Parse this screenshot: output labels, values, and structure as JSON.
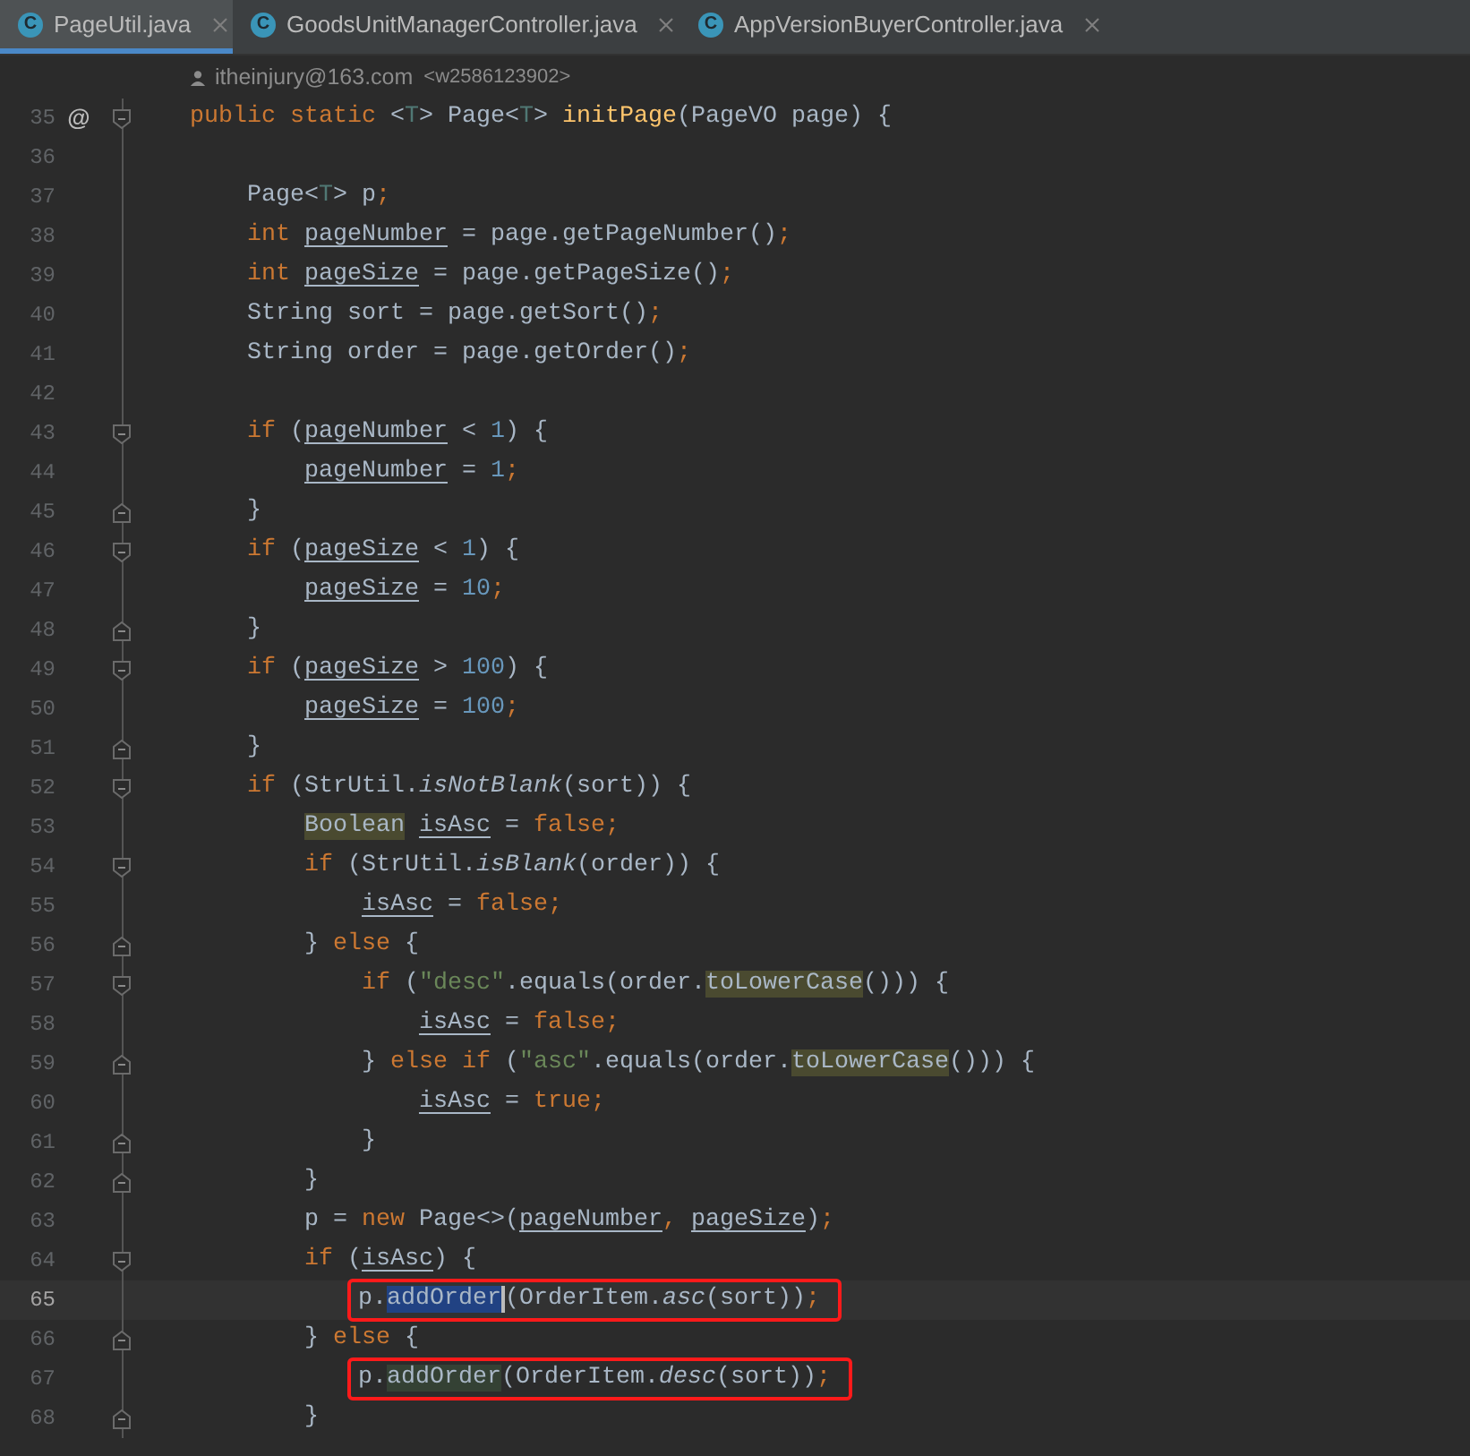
{
  "tabs": [
    {
      "icon_letter": "C",
      "label": "PageUtil.java",
      "selected": true
    },
    {
      "icon_letter": "C",
      "label": "GoodsUnitManagerController.java",
      "selected": false
    },
    {
      "icon_letter": "C",
      "label": "AppVersionBuyerController.java",
      "selected": false
    }
  ],
  "author": {
    "name": "itheinjury@163.com",
    "handle": "<w2586123902>"
  },
  "lines": [
    {
      "number": "35",
      "gutter_mark": "@",
      "fold_start": true,
      "fold_end": false,
      "tokens": [
        {
          "text": "public static ",
          "kind": "keyword"
        },
        {
          "text": "<",
          "kind": "plain"
        },
        {
          "text": "T",
          "kind": "typeparam"
        },
        {
          "text": "> Page<",
          "kind": "plain"
        },
        {
          "text": "T",
          "kind": "typeparam"
        },
        {
          "text": "> ",
          "kind": "plain"
        },
        {
          "text": "initPage",
          "kind": "declaration"
        },
        {
          "text": "(PageVO page) {",
          "kind": "plain"
        }
      ]
    },
    {
      "number": "36",
      "fold_start": false,
      "fold_end": false
    },
    {
      "number": "37",
      "fold_start": false,
      "fold_end": false,
      "tokens": [
        {
          "text": "    Page<",
          "kind": "plain"
        },
        {
          "text": "T",
          "kind": "typeparam"
        },
        {
          "text": "> p",
          "kind": "plain"
        },
        {
          "text": ";",
          "kind": "keyword"
        }
      ]
    },
    {
      "number": "38",
      "fold_start": false,
      "fold_end": false,
      "tokens": [
        {
          "text": "    int ",
          "kind": "keyword"
        },
        {
          "text": "pageNumber",
          "kind": "var"
        },
        {
          "text": " = page.getPageNumber()",
          "kind": "plain"
        },
        {
          "text": ";",
          "kind": "keyword"
        }
      ]
    },
    {
      "number": "39",
      "fold_start": false,
      "fold_end": false,
      "tokens": [
        {
          "text": "    int ",
          "kind": "keyword"
        },
        {
          "text": "pageSize",
          "kind": "var"
        },
        {
          "text": " = page.getPageSize()",
          "kind": "plain"
        },
        {
          "text": ";",
          "kind": "keyword"
        }
      ]
    },
    {
      "number": "40",
      "fold_start": false,
      "fold_end": false,
      "tokens": [
        {
          "text": "    String sort = page.getSort()",
          "kind": "plain"
        },
        {
          "text": ";",
          "kind": "keyword"
        }
      ]
    },
    {
      "number": "41",
      "fold_start": false,
      "fold_end": false,
      "tokens": [
        {
          "text": "    String order = page.getOrder()",
          "kind": "plain"
        },
        {
          "text": ";",
          "kind": "keyword"
        }
      ]
    },
    {
      "number": "42",
      "fold_start": false,
      "fold_end": false
    },
    {
      "number": "43",
      "fold_start": true,
      "fold_end": false,
      "tokens": [
        {
          "text": "    if ",
          "kind": "keyword"
        },
        {
          "text": "(",
          "kind": "plain"
        },
        {
          "text": "pageNumber",
          "kind": "var"
        },
        {
          "text": " < ",
          "kind": "plain"
        },
        {
          "text": "1",
          "kind": "number"
        },
        {
          "text": ") {",
          "kind": "plain"
        }
      ]
    },
    {
      "number": "44",
      "fold_start": false,
      "fold_end": false,
      "tokens": [
        {
          "text": "        pageNumber",
          "kind": "var"
        },
        {
          "text": " = ",
          "kind": "plain"
        },
        {
          "text": "1",
          "kind": "number"
        },
        {
          "text": ";",
          "kind": "keyword"
        }
      ]
    },
    {
      "number": "45",
      "fold_start": false,
      "fold_end": true,
      "tokens": [
        {
          "text": "    }",
          "kind": "plain"
        }
      ]
    },
    {
      "number": "46",
      "fold_start": true,
      "fold_end": false,
      "tokens": [
        {
          "text": "    if ",
          "kind": "keyword"
        },
        {
          "text": "(",
          "kind": "plain"
        },
        {
          "text": "pageSize",
          "kind": "var"
        },
        {
          "text": " < ",
          "kind": "plain"
        },
        {
          "text": "1",
          "kind": "number"
        },
        {
          "text": ") {",
          "kind": "plain"
        }
      ]
    },
    {
      "number": "47",
      "fold_start": false,
      "fold_end": false,
      "tokens": [
        {
          "text": "        pageSize",
          "kind": "var"
        },
        {
          "text": " = ",
          "kind": "plain"
        },
        {
          "text": "10",
          "kind": "number"
        },
        {
          "text": ";",
          "kind": "keyword"
        }
      ]
    },
    {
      "number": "48",
      "fold_start": false,
      "fold_end": true,
      "tokens": [
        {
          "text": "    }",
          "kind": "plain"
        }
      ]
    },
    {
      "number": "49",
      "fold_start": true,
      "fold_end": false,
      "tokens": [
        {
          "text": "    if ",
          "kind": "keyword"
        },
        {
          "text": "(",
          "kind": "plain"
        },
        {
          "text": "pageSize",
          "kind": "var"
        },
        {
          "text": " > ",
          "kind": "plain"
        },
        {
          "text": "100",
          "kind": "number"
        },
        {
          "text": ") {",
          "kind": "plain"
        }
      ]
    },
    {
      "number": "50",
      "fold_start": false,
      "fold_end": false,
      "tokens": [
        {
          "text": "        pageSize",
          "kind": "var"
        },
        {
          "text": " = ",
          "kind": "plain"
        },
        {
          "text": "100",
          "kind": "number"
        },
        {
          "text": ";",
          "kind": "keyword"
        }
      ]
    },
    {
      "number": "51",
      "fold_start": false,
      "fold_end": true,
      "tokens": [
        {
          "text": "    }",
          "kind": "plain"
        }
      ]
    },
    {
      "number": "52",
      "fold_start": true,
      "fold_end": false,
      "tokens": [
        {
          "text": "    if ",
          "kind": "keyword"
        },
        {
          "text": "(StrUtil.",
          "kind": "plain"
        },
        {
          "text": "isNotBlank",
          "kind": "static"
        },
        {
          "text": "(sort)) {",
          "kind": "plain"
        }
      ]
    },
    {
      "number": "53",
      "fold_start": false,
      "fold_end": false,
      "tokens": [
        {
          "text": "        Boolean",
          "kind": "usage"
        },
        {
          "text": " isAsc",
          "kind": "var"
        },
        {
          "text": " = ",
          "kind": "plain"
        },
        {
          "text": "false",
          "kind": "keyword"
        },
        {
          "text": ";",
          "kind": "keyword"
        }
      ]
    },
    {
      "number": "54",
      "fold_start": true,
      "fold_end": false,
      "tokens": [
        {
          "text": "        if ",
          "kind": "keyword"
        },
        {
          "text": "(StrUtil.",
          "kind": "plain"
        },
        {
          "text": "isBlank",
          "kind": "static"
        },
        {
          "text": "(order)) {",
          "kind": "plain"
        }
      ]
    },
    {
      "number": "55",
      "fold_start": false,
      "fold_end": false,
      "tokens": [
        {
          "text": "            isAsc",
          "kind": "var"
        },
        {
          "text": " = ",
          "kind": "plain"
        },
        {
          "text": "false;",
          "kind": "keyword"
        }
      ]
    },
    {
      "number": "56",
      "fold_start": false,
      "fold_end": true,
      "tokens": [
        {
          "text": "        } ",
          "kind": "plain"
        },
        {
          "text": "else ",
          "kind": "keyword"
        },
        {
          "text": "{",
          "kind": "plain"
        }
      ]
    },
    {
      "number": "57",
      "fold_start": true,
      "fold_end": false,
      "tokens": [
        {
          "text": "            if ",
          "kind": "keyword"
        },
        {
          "text": "(",
          "kind": "plain"
        },
        {
          "text": "\"desc\"",
          "kind": "string"
        },
        {
          "text": ".equals(order.",
          "kind": "plain"
        },
        {
          "text": "toLowerCase",
          "kind": "usage"
        },
        {
          "text": "())) {",
          "kind": "plain"
        }
      ]
    },
    {
      "number": "58",
      "fold_start": false,
      "fold_end": false,
      "tokens": [
        {
          "text": "                isAsc",
          "kind": "var"
        },
        {
          "text": " = ",
          "kind": "plain"
        },
        {
          "text": "false;",
          "kind": "keyword"
        }
      ]
    },
    {
      "number": "59",
      "fold_start": false,
      "fold_end": true,
      "tokens": [
        {
          "text": "            } ",
          "kind": "plain"
        },
        {
          "text": "else if ",
          "kind": "keyword"
        },
        {
          "text": "(",
          "kind": "plain"
        },
        {
          "text": "\"asc\"",
          "kind": "string"
        },
        {
          "text": ".equals(order.",
          "kind": "plain"
        },
        {
          "text": "toLowerCase",
          "kind": "usage"
        },
        {
          "text": "())) {",
          "kind": "plain"
        }
      ]
    },
    {
      "number": "60",
      "fold_start": false,
      "fold_end": false,
      "tokens": [
        {
          "text": "                isAsc",
          "kind": "var"
        },
        {
          "text": " = ",
          "kind": "plain"
        },
        {
          "text": "true;",
          "kind": "keyword"
        }
      ]
    },
    {
      "number": "61",
      "fold_start": false,
      "fold_end": true,
      "tokens": [
        {
          "text": "            }",
          "kind": "plain"
        }
      ]
    },
    {
      "number": "62",
      "fold_start": false,
      "fold_end": true,
      "tokens": [
        {
          "text": "        }",
          "kind": "plain"
        }
      ]
    },
    {
      "number": "63",
      "fold_start": false,
      "fold_end": false,
      "tokens": [
        {
          "text": "        p = ",
          "kind": "plain"
        },
        {
          "text": "new ",
          "kind": "keyword"
        },
        {
          "text": "Page<>(",
          "kind": "plain"
        },
        {
          "text": "pageNumber",
          "kind": "var"
        },
        {
          "text": ", ",
          "kind": "keyword"
        },
        {
          "text": "pageSize",
          "kind": "var"
        },
        {
          "text": ")",
          "kind": "plain"
        },
        {
          "text": ";",
          "kind": "keyword"
        }
      ]
    },
    {
      "number": "64",
      "fold_start": true,
      "fold_end": false,
      "tokens": [
        {
          "text": "        if ",
          "kind": "keyword"
        },
        {
          "text": "(",
          "kind": "plain"
        },
        {
          "text": "isAsc",
          "kind": "var"
        },
        {
          "text": ") {",
          "kind": "plain"
        }
      ]
    },
    {
      "number": "65",
      "fold_start": false,
      "fold_end": false,
      "current": true,
      "boxed": true,
      "tokens": [
        {
          "text": "            p.",
          "kind": "plain"
        },
        {
          "text": "addOrder",
          "kind": "selection"
        },
        {
          "text": "(OrderItem.",
          "kind": "plain"
        },
        {
          "text": "asc",
          "kind": "static"
        },
        {
          "text": "(sort))",
          "kind": "plain"
        },
        {
          "text": ";",
          "kind": "keyword"
        }
      ]
    },
    {
      "number": "66",
      "fold_start": false,
      "fold_end": true,
      "tokens": [
        {
          "text": "        } ",
          "kind": "plain"
        },
        {
          "text": "else ",
          "kind": "keyword"
        },
        {
          "text": "{",
          "kind": "plain"
        }
      ]
    },
    {
      "number": "67",
      "fold_start": false,
      "fold_end": false,
      "boxed": true,
      "tokens": [
        {
          "text": "            p.",
          "kind": "plain"
        },
        {
          "text": "addOrder",
          "kind": "write"
        },
        {
          "text": "(OrderItem.",
          "kind": "plain"
        },
        {
          "text": "desc",
          "kind": "static"
        },
        {
          "text": "(sort))",
          "kind": "plain"
        },
        {
          "text": ";",
          "kind": "keyword"
        }
      ]
    },
    {
      "number": "68",
      "fold_start": false,
      "fold_end": true,
      "tokens": [
        {
          "text": "        }",
          "kind": "plain"
        }
      ]
    }
  ]
}
